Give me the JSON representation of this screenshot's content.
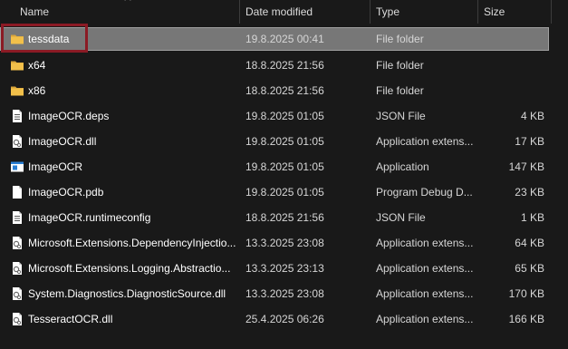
{
  "columns": {
    "name": "Name",
    "date": "Date modified",
    "type": "Type",
    "size": "Size"
  },
  "files": [
    {
      "name": "tessdata",
      "date": "19.8.2025 00:41",
      "type": "File folder",
      "size": "",
      "icon": "folder-icon",
      "selected": true
    },
    {
      "name": "x64",
      "date": "18.8.2025 21:56",
      "type": "File folder",
      "size": "",
      "icon": "folder-icon"
    },
    {
      "name": "x86",
      "date": "18.8.2025 21:56",
      "type": "File folder",
      "size": "",
      "icon": "folder-icon"
    },
    {
      "name": "ImageOCR.deps",
      "date": "19.8.2025 01:05",
      "type": "JSON File",
      "size": "4 KB",
      "icon": "json-file-icon"
    },
    {
      "name": "ImageOCR.dll",
      "date": "19.8.2025 01:05",
      "type": "Application extens...",
      "size": "17 KB",
      "icon": "dll-file-icon"
    },
    {
      "name": "ImageOCR",
      "date": "19.8.2025 01:05",
      "type": "Application",
      "size": "147 KB",
      "icon": "application-icon"
    },
    {
      "name": "ImageOCR.pdb",
      "date": "19.8.2025 01:05",
      "type": "Program Debug D...",
      "size": "23 KB",
      "icon": "blank-file-icon"
    },
    {
      "name": "ImageOCR.runtimeconfig",
      "date": "18.8.2025 21:56",
      "type": "JSON File",
      "size": "1 KB",
      "icon": "json-file-icon"
    },
    {
      "name": "Microsoft.Extensions.DependencyInjectio...",
      "date": "13.3.2025 23:08",
      "type": "Application extens...",
      "size": "64 KB",
      "icon": "dll-file-icon"
    },
    {
      "name": "Microsoft.Extensions.Logging.Abstractio...",
      "date": "13.3.2025 23:13",
      "type": "Application extens...",
      "size": "65 KB",
      "icon": "dll-file-icon"
    },
    {
      "name": "System.Diagnostics.DiagnosticSource.dll",
      "date": "13.3.2025 23:08",
      "type": "Application extens...",
      "size": "170 KB",
      "icon": "dll-file-icon"
    },
    {
      "name": "TesseractOCR.dll",
      "date": "25.4.2025 06:26",
      "type": "Application extens...",
      "size": "166 KB",
      "icon": "dll-file-icon"
    }
  ],
  "colors": {
    "background": "#191919",
    "selection": "#777777",
    "highlight": "#8b1a24",
    "folder": "#f2c04a"
  }
}
